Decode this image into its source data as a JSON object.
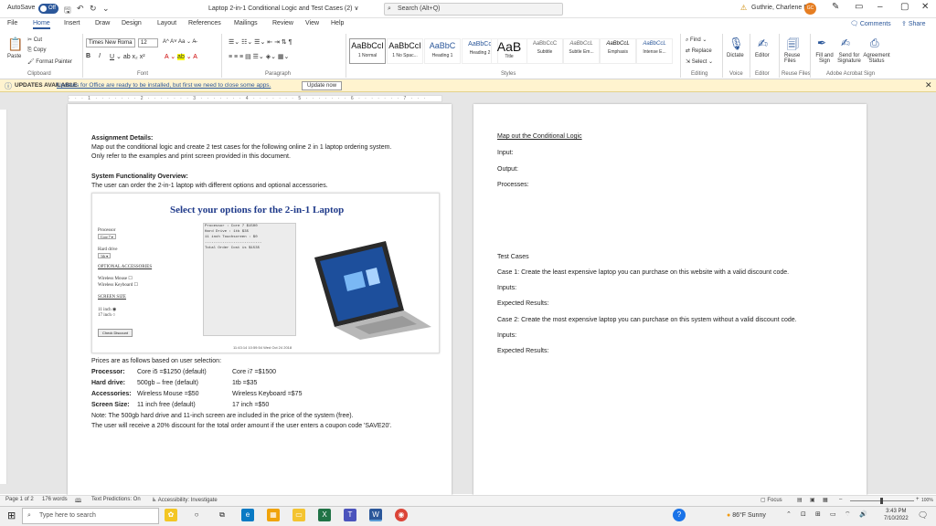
{
  "titlebar": {
    "autosave": "AutoSave",
    "toggle": "Off",
    "doc_title": "Laptop 2-in-1 Conditional Logic and Test Cases (2) ∨",
    "search_placeholder": "Search (Alt+Q)",
    "user_name": "Guthrie, Charlene R",
    "user_initials": "GC"
  },
  "tabs": [
    "File",
    "Home",
    "Insert",
    "Draw",
    "Design",
    "Layout",
    "References",
    "Mailings",
    "Review",
    "View",
    "Help"
  ],
  "actions": {
    "comments": "Comments",
    "share": "Share"
  },
  "ribbon": {
    "clipboard": {
      "paste": "Paste",
      "cut": "Cut",
      "copy": "Copy",
      "format_painter": "Format Painter",
      "group": "Clipboard"
    },
    "font": {
      "name": "Times New Roma",
      "size": "12",
      "group": "Font"
    },
    "paragraph": {
      "group": "Paragraph"
    },
    "styles": {
      "group": "Styles",
      "items": [
        {
          "sample": "AaBbCcI",
          "label": "1 Normal"
        },
        {
          "sample": "AaBbCcI",
          "label": "1 No Spac..."
        },
        {
          "sample": "AaBbC",
          "label": "Heading 1"
        },
        {
          "sample": "AaBbCc",
          "label": "Heading 2"
        },
        {
          "sample": "AaB",
          "label": "Title"
        },
        {
          "sample": "AaBbCcC",
          "label": "Subtitle"
        },
        {
          "sample": "AaBbCcL",
          "label": "Subtle Em..."
        },
        {
          "sample": "AaBbCcL",
          "label": "Emphasis"
        },
        {
          "sample": "AaBbCcL",
          "label": "Intense E..."
        }
      ]
    },
    "editing": {
      "find": "Find",
      "replace": "Replace",
      "select": "Select",
      "group": "Editing"
    },
    "voice": {
      "dictate": "Dictate",
      "group": "Voice"
    },
    "editor": {
      "label": "Editor",
      "group": "Editor"
    },
    "reuse": {
      "label": "Reuse Files",
      "group": "Reuse Files"
    },
    "adobe": {
      "fill_sign": "Fill and Sign",
      "send_sig": "Send for Signature",
      "agreement": "Agreement Status",
      "group": "Adobe Acrobat Sign"
    }
  },
  "update_bar": {
    "title": "UPDATES AVAILABLE",
    "message": "Updates for Office are ready to be installed, but first we need to close some apps.",
    "button": "Update now"
  },
  "ruler": "· · · 1 · · · · · · · 2 · · · · · · · 3 · · · · · · · 4 · · · · · · · 5 · · · · · · · 6 · · · · · · · 7 · · ·",
  "page1": {
    "assignment_heading": "Assignment Details:",
    "assignment_line1": "Map out the conditional logic and create 2 test cases for the following online 2 in 1 laptop ordering system.",
    "assignment_line2": "Only refer to the examples and print screen provided in this document.",
    "overview_heading": "System Functionality Overview:",
    "overview_line": "The user can order the 2-in-1 laptop with different options and optional accessories.",
    "laptop_form": {
      "title": "Select your options for the 2-in-1 Laptop",
      "processor_label": "Processor",
      "processor_value": "Core 7 ▾",
      "harddrive_label": "Hard drive",
      "harddrive_value": "1tb ▾",
      "accessories_heading": "OPTIONAL ACCESSORIES",
      "mouse": "Wireless Mouse",
      "keyboard": "Wireless Keyboard",
      "screen_heading": "SCREEN SIZE",
      "screen11": "11 inch",
      "screen17": "17 inch",
      "check_button": "Check Discount",
      "summary_line1": "Processor : Core 7 $1500",
      "summary_line2": "Hard Drive : 1tb $35",
      "summary_line3": "11 inch Touchscreen : $0",
      "summary_sep": "--------------------------",
      "summary_total": "Total Order Cost is $1535",
      "timestamp": "11:43:14 10:59:54 Wed Oct 24 2018"
    },
    "prices_intro": "Prices are as follows based on user selection:",
    "prices": [
      {
        "label": "Processor:",
        "opt1": "Core i5 =$1250 (default)",
        "opt2": "Core i7 =$1500"
      },
      {
        "label": "Hard drive:",
        "opt1": "500gb – free (default)",
        "opt2": "1tb =$35"
      },
      {
        "label": "Accessories:",
        "opt1": "Wireless Mouse =$50",
        "opt2": "Wireless Keyboard =$75"
      },
      {
        "label": "Screen Size:",
        "opt1": "11 inch free (default)",
        "opt2": "17 inch =$50"
      }
    ],
    "note1": "Note: The 500gb hard drive and 11-inch screen are included in the price of the system (free).",
    "note2": "The user will receive a 20% discount for the total order amount if the user enters a coupon code 'SAVE20'."
  },
  "page2": {
    "heading": "Map out the Conditional Logic",
    "input": "Input:",
    "output": "Output:",
    "processes": "Processes:",
    "test_cases": "Test Cases",
    "case1": "Case 1: Create the least expensive laptop you can purchase on this website with a valid discount code.",
    "inputs1": "Inputs:",
    "expected1": "Expected Results:",
    "case2": "Case 2: Create the most expensive laptop you can purchase on this system without a valid discount code.",
    "inputs2": "Inputs:",
    "expected2": "Expected Results:"
  },
  "statusbar": {
    "page": "Page 1 of 2",
    "words": "176 words",
    "predictions": "Text Predictions: On",
    "accessibility": "Accessibility: Investigate",
    "focus": "Focus",
    "zoom": "100%"
  },
  "taskbar": {
    "search": "Type here to search",
    "weather": "86°F Sunny",
    "time": "3:43 PM",
    "date": "7/10/2022"
  }
}
